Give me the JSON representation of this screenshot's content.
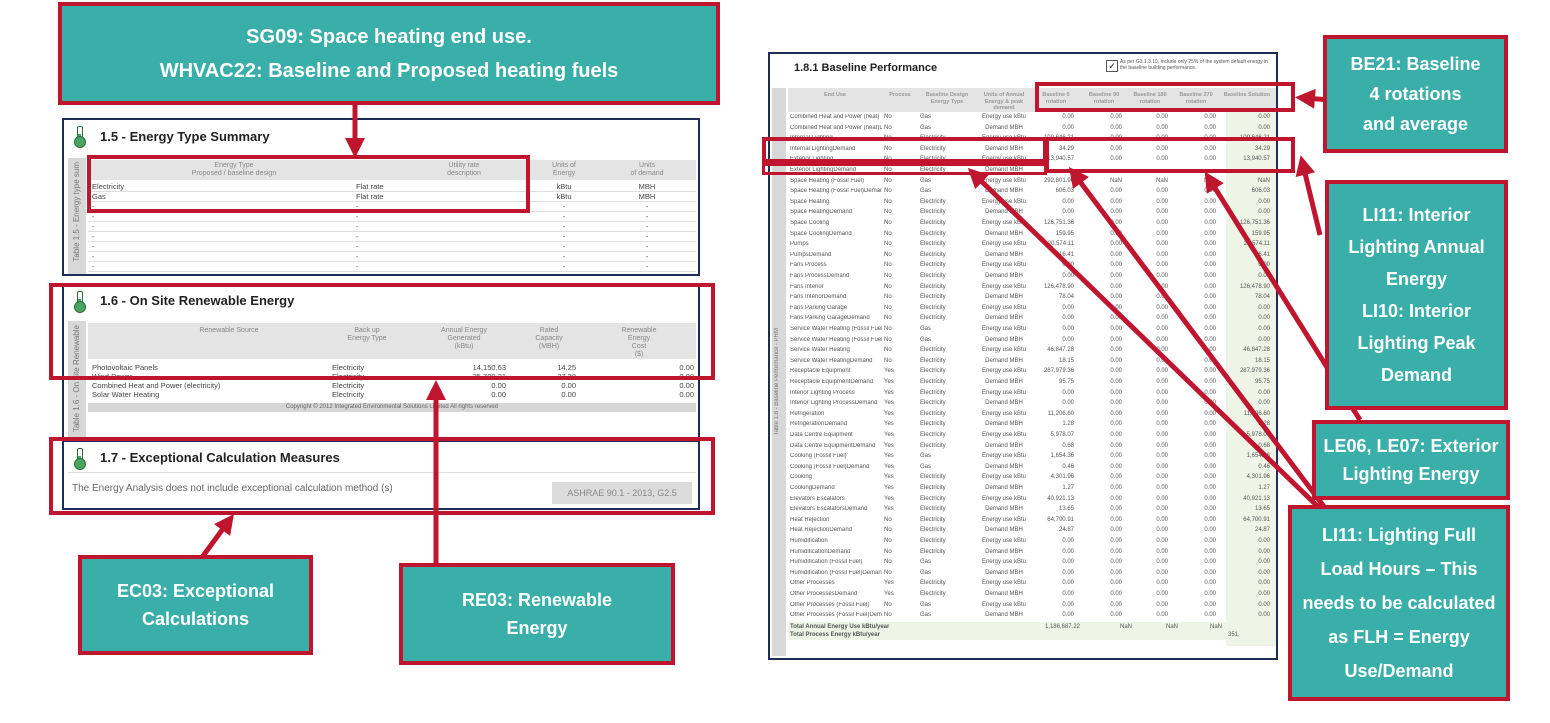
{
  "colors": {
    "callout_fill": "#3aaea9",
    "highlight_red": "#c0152f",
    "panel_border": "#1e2e58",
    "header_grey": "#e4e4e4"
  },
  "callouts": {
    "sg09": {
      "line1": "SG09: Space heating end use.",
      "line2": "WHVAC22: Baseline and Proposed heating fuels"
    },
    "ec03": {
      "line1": "EC03: Exceptional",
      "line2": "Calculations"
    },
    "re03": {
      "line1": "RE03: Renewable",
      "line2": "Energy"
    },
    "be21": {
      "line1": "BE21: Baseline",
      "line2": "4 rotations",
      "line3": "and average"
    },
    "li11_li10": {
      "lines": [
        "LI11: Interior",
        "Lighting Annual",
        "Energy",
        "LI10: Interior",
        "Lighting Peak",
        "Demand"
      ]
    },
    "le06": {
      "line1": "LE06, LE07: Exterior",
      "line2": "Lighting Energy"
    },
    "li11_flh": {
      "lines": [
        "LI11: Lighting Full",
        "Load Hours – This",
        "needs to be calculated",
        "as FLH = Energy",
        "Use/Demand"
      ]
    }
  },
  "energy_type_summary": {
    "title": "1.5 - Energy Type Summary",
    "sidebar_label": "Table 1.5 - Energy type sum",
    "headers": [
      "Energy Type\nProposed / baseline design",
      "Utility rate\ndescription",
      "Units of\nEnergy",
      "Units\nof demand"
    ],
    "rows": [
      [
        "Electricity",
        "Flat rate",
        "kBtu",
        "MBH"
      ],
      [
        "Gas",
        "Flat rate",
        "kBtu",
        "MBH"
      ],
      [
        "-",
        "-",
        "-",
        "-"
      ],
      [
        "-",
        "-",
        "-",
        "-"
      ],
      [
        "-",
        "-",
        "-",
        "-"
      ],
      [
        "-",
        "-",
        "-",
        "-"
      ],
      [
        "-",
        "-",
        "-",
        "-"
      ],
      [
        "-",
        "-",
        "-",
        "-"
      ],
      [
        "-",
        "-",
        "-",
        "-"
      ]
    ]
  },
  "onsite_renewable": {
    "title": "1.6 - On Site Renewable Energy",
    "sidebar_label": "Table 1.6 - On site Renewable",
    "headers": [
      "Renewable Source",
      "Back up\nEnergy Type",
      "Annual Energy\nGenerated\n(kBtu)",
      "Rated\nCapacity\n(MBH)",
      "Renewable\nEnergy\nCost\n($)"
    ],
    "rows": [
      [
        "Photovoltaic Panels",
        "Electricity",
        "14,150.63",
        "14.25",
        "0.00"
      ],
      [
        "Wind Power",
        "Electricity",
        "35,700.21",
        "27.30",
        "0.00"
      ],
      [
        "Combined Heat and Power (electricity)",
        "Electricity",
        "0.00",
        "0.00",
        "0.00"
      ],
      [
        "Solar Water Heating",
        "Electricity",
        "0.00",
        "0.00",
        "0.00"
      ]
    ],
    "copyright": "Copyright © 2012 Integrated Environmental Solutions Limited All rights reserved"
  },
  "exceptional_calc": {
    "title": "1.7 - Exceptional Calculation Measures",
    "text": "The Energy Analysis does not include exceptional calculation method (s)",
    "standard": "ASHRAE 90.1 - 2013, G2.5"
  },
  "baseline_performance": {
    "title": "1.8.1 Baseline Performance",
    "checkbox_text": "As per G3.1.3.10, include only 25% of the system default energy in the baseline building performance.",
    "sidebar_label": "Table 1.8 - Baseline Performance - PRM",
    "headers": [
      "End Use",
      "Process",
      "Baseline Design Energy Type",
      "Units of Annual Energy & peak demand",
      "Baseline 0 rotation",
      "Baseline 90 rotation",
      "Baseline 180 rotation",
      "Baseline 270 rotation",
      "Baseline Solution"
    ],
    "rows": [
      [
        "Combined Heat and Power (heat)",
        "No",
        "Gas",
        "Energy use kBtu",
        "0.00",
        "0.00",
        "0.00",
        "0.00",
        "0.00"
      ],
      [
        "Combined Heat and Power (heat)Demand",
        "No",
        "Gas",
        "Demand MBH",
        "0.00",
        "0.00",
        "0.00",
        "0.00",
        "0.00"
      ],
      [
        "Internal Lighting",
        "No",
        "Electricity",
        "Energy use kBtu",
        "109,646.21",
        "0.00",
        "0.00",
        "0.00",
        "109,646.21"
      ],
      [
        "Internal LightingDemand",
        "No",
        "Electricity",
        "Demand MBH",
        "34.29",
        "0.00",
        "0.00",
        "0.00",
        "34.29"
      ],
      [
        "Exterior Lighting",
        "No",
        "Electricity",
        "Energy use kBtu",
        "13,940.57",
        "0.00",
        "0.00",
        "0.00",
        "13,940.57"
      ],
      [
        "Exterior LightingDemand",
        "No",
        "Electricity",
        "Demand MBH",
        "",
        "",
        "",
        "",
        ""
      ],
      [
        "Space Heating (Fossil Fuel)",
        "No",
        "Gas",
        "Energy use kBtu",
        "292,801.90",
        "NaN",
        "NaN",
        "NaN",
        "NaN"
      ],
      [
        "Space Heating (Fossil Fuel)Demand",
        "No",
        "Gas",
        "Demand MBH",
        "606.03",
        "0.00",
        "0.00",
        "0.00",
        "606.03"
      ],
      [
        "Space Heating",
        "No",
        "Electricity",
        "Energy use kBtu",
        "0.00",
        "0.00",
        "0.00",
        "0.00",
        "0.00"
      ],
      [
        "Space HeatingDemand",
        "No",
        "Electricity",
        "Demand MBH",
        "0.00",
        "0.00",
        "0.00",
        "0.00",
        "0.00"
      ],
      [
        "Space Cooling",
        "No",
        "Electricity",
        "Energy use kBtu",
        "126,751.36",
        "0.00",
        "0.00",
        "0.00",
        "126,751.36"
      ],
      [
        "Space CoolingDemand",
        "No",
        "Electricity",
        "Demand MBH",
        "159.95",
        "0.00",
        "0.00",
        "0.00",
        "159.95"
      ],
      [
        "Pumps",
        "No",
        "Electricity",
        "Energy use kBtu",
        "20,574.11",
        "0.00",
        "0.00",
        "0.00",
        "20,574.11"
      ],
      [
        "PumpsDemand",
        "No",
        "Electricity",
        "Demand MBH",
        "16.41",
        "0.00",
        "0.00",
        "0.00",
        "16.41"
      ],
      [
        "Fans Process",
        "No",
        "Electricity",
        "Energy use kBtu",
        "0.00",
        "0.00",
        "0.00",
        "0.00",
        "0.00"
      ],
      [
        "Fans ProcessDemand",
        "No",
        "Electricity",
        "Demand MBH",
        "0.00",
        "0.00",
        "0.00",
        "0.00",
        "0.00"
      ],
      [
        "Fans Interior",
        "No",
        "Electricity",
        "Energy use kBtu",
        "126,478.90",
        "0.00",
        "0.00",
        "0.00",
        "126,478.90"
      ],
      [
        "Fans InteriorDemand",
        "No",
        "Electricity",
        "Demand MBH",
        "78.04",
        "0.00",
        "0.00",
        "0.00",
        "78.04"
      ],
      [
        "Fans Parking Garage",
        "No",
        "Electricity",
        "Energy use kBtu",
        "0.00",
        "0.00",
        "0.00",
        "0.00",
        "0.00"
      ],
      [
        "Fans Parking GarageDemand",
        "No",
        "Electricity",
        "Demand MBH",
        "0.00",
        "0.00",
        "0.00",
        "0.00",
        "0.00"
      ],
      [
        "Service Water Heating (Fossil Fuel)",
        "No",
        "Gas",
        "Energy use kBtu",
        "0.00",
        "0.00",
        "0.00",
        "0.00",
        "0.00"
      ],
      [
        "Service Water Heating (Fossil Fuel)Demand",
        "No",
        "Gas",
        "Demand MBH",
        "0.00",
        "0.00",
        "0.00",
        "0.00",
        "0.00"
      ],
      [
        "Service Water Heating",
        "No",
        "Electricity",
        "Energy use kBtu",
        "46,847.28",
        "0.00",
        "0.00",
        "0.00",
        "46,847.28"
      ],
      [
        "Service Water HeatingDemand",
        "No",
        "Electricity",
        "Demand MBH",
        "18.15",
        "0.00",
        "0.00",
        "0.00",
        "18.15"
      ],
      [
        "Receptacle Equipment",
        "Yes",
        "Electricity",
        "Energy use kBtu",
        "287,979.36",
        "0.00",
        "0.00",
        "0.00",
        "287,979.36"
      ],
      [
        "Receptacle EquipmentDemand",
        "Yes",
        "Electricity",
        "Demand MBH",
        "95.75",
        "0.00",
        "0.00",
        "0.00",
        "95.75"
      ],
      [
        "Interior Lighting Process",
        "Yes",
        "Electricity",
        "Energy use kBtu",
        "0.00",
        "0.00",
        "0.00",
        "0.00",
        "0.00"
      ],
      [
        "Interior Lighting ProcessDemand",
        "Yes",
        "Electricity",
        "Demand MBH",
        "0.00",
        "0.00",
        "0.00",
        "0.00",
        "0.00"
      ],
      [
        "Refrigeration",
        "Yes",
        "Electricity",
        "Energy use kBtu",
        "11,206.60",
        "0.00",
        "0.00",
        "0.00",
        "11,206.60"
      ],
      [
        "RefrigerationDemand",
        "Yes",
        "Electricity",
        "Demand MBH",
        "1.28",
        "0.00",
        "0.00",
        "0.00",
        "1.28"
      ],
      [
        "Data Centre Equipment",
        "Yes",
        "Electricity",
        "Energy use kBtu",
        "5,978.07",
        "0.00",
        "0.00",
        "0.00",
        "5,978.07"
      ],
      [
        "Data Centre EquipmentDemand",
        "Yes",
        "Electricity",
        "Demand MBH",
        "0.68",
        "0.00",
        "0.00",
        "0.00",
        "0.68"
      ],
      [
        "Cooking (Fossil Fuel)",
        "Yes",
        "Gas",
        "Energy use kBtu",
        "1,654.36",
        "0.00",
        "0.00",
        "0.00",
        "1,654.36"
      ],
      [
        "Cooking (Fossil Fuel)Demand",
        "Yes",
        "Gas",
        "Demand MBH",
        "0.46",
        "0.00",
        "0.00",
        "0.00",
        "0.46"
      ],
      [
        "Cooking",
        "Yes",
        "Electricity",
        "Energy use kBtu",
        "4,301.96",
        "0.00",
        "0.00",
        "0.00",
        "4,301.96"
      ],
      [
        "CookingDemand",
        "Yes",
        "Electricity",
        "Demand MBH",
        "1.27",
        "0.00",
        "0.00",
        "0.00",
        "1.27"
      ],
      [
        "Elevators Escalators",
        "Yes",
        "Electricity",
        "Energy use kBtu",
        "40,921.13",
        "0.00",
        "0.00",
        "0.00",
        "40,921.13"
      ],
      [
        "Elevators EscalatorsDemand",
        "Yes",
        "Electricity",
        "Demand MBH",
        "13.65",
        "0.00",
        "0.00",
        "0.00",
        "13.65"
      ],
      [
        "Heat Rejection",
        "No",
        "Electricity",
        "Energy use kBtu",
        "64,700.91",
        "0.00",
        "0.00",
        "0.00",
        "64,700.91"
      ],
      [
        "Heat RejectionDemand",
        "No",
        "Electricity",
        "Demand MBH",
        "24.87",
        "0.00",
        "0.00",
        "0.00",
        "24.87"
      ],
      [
        "Humidification",
        "No",
        "Electricity",
        "Energy use kBtu",
        "0.00",
        "0.00",
        "0.00",
        "0.00",
        "0.00"
      ],
      [
        "HumidificationDemand",
        "No",
        "Electricity",
        "Demand MBH",
        "0.00",
        "0.00",
        "0.00",
        "0.00",
        "0.00"
      ],
      [
        "Humidification (Fossil Fuel)",
        "No",
        "Gas",
        "Energy use kBtu",
        "0.00",
        "0.00",
        "0.00",
        "0.00",
        "0.00"
      ],
      [
        "Humidification (Fossil Fuel)Demand",
        "No",
        "Gas",
        "Demand MBH",
        "0.00",
        "0.00",
        "0.00",
        "0.00",
        "0.00"
      ],
      [
        "Other Processes",
        "Yes",
        "Electricity",
        "Energy use kBtu",
        "0.00",
        "0.00",
        "0.00",
        "0.00",
        "0.00"
      ],
      [
        "Other ProcessesDemand",
        "Yes",
        "Electricity",
        "Demand MBH",
        "0.00",
        "0.00",
        "0.00",
        "0.00",
        "0.00"
      ],
      [
        "Other Processes (Fossil Fuel)",
        "No",
        "Gas",
        "Energy use kBtu",
        "0.00",
        "0.00",
        "0.00",
        "0.00",
        "0.00"
      ],
      [
        "Other Processes (Fossil Fuel)Demand",
        "No",
        "Gas",
        "Demand MBH",
        "0.00",
        "0.00",
        "0.00",
        "0.00",
        "0.00"
      ]
    ],
    "total_annual_label": "Total Annual Energy Use kBtu/year",
    "total_annual_values": [
      "1,186,687.22",
      "NaN",
      "NaN",
      "NaN"
    ],
    "total_process_label": "Total Process Energy kBtu/year",
    "total_process_value": "351,"
  }
}
